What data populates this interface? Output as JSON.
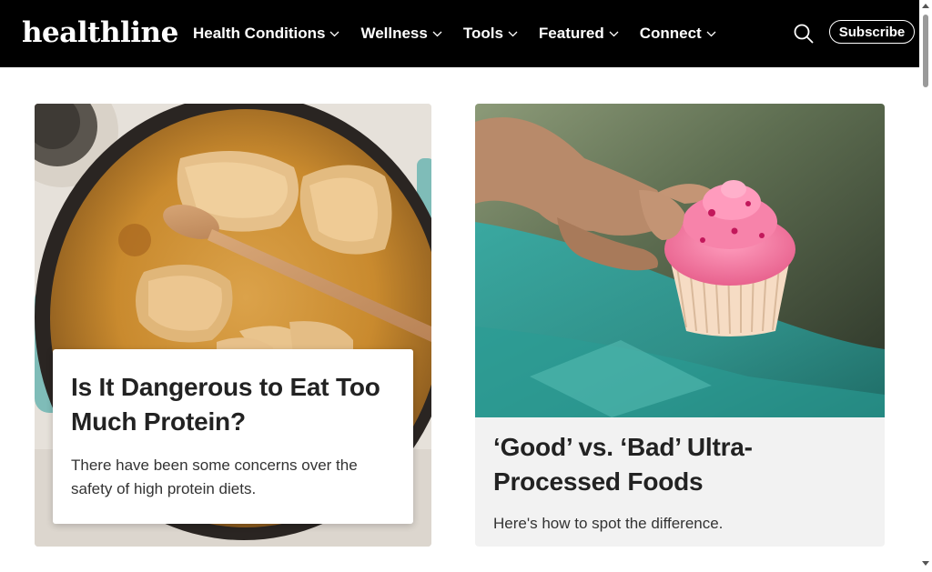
{
  "header": {
    "logo": "healthline",
    "nav": [
      {
        "label": "Health Conditions"
      },
      {
        "label": "Wellness"
      },
      {
        "label": "Tools"
      },
      {
        "label": "Featured"
      },
      {
        "label": "Connect"
      }
    ],
    "search_icon": "search-icon",
    "subscribe_label": "Subscribe"
  },
  "main": {
    "cards": [
      {
        "headline": "Is It Dangerous to Eat Too Much Protein?",
        "dek": "There have been some concerns over the safety of high protein diets.",
        "image": "chicken-in-skillet-photo"
      },
      {
        "headline": "‘Good’ vs. ‘Bad’ Ultra-Processed Foods",
        "dek": "Here's how to spot the difference.",
        "image": "hand-holding-cupcake-photo"
      }
    ]
  },
  "colors": {
    "header_bg": "#000000",
    "header_text": "#ffffff",
    "headline": "#222222",
    "body_text": "#333333",
    "card_b_bg": "#f2f2f2"
  }
}
